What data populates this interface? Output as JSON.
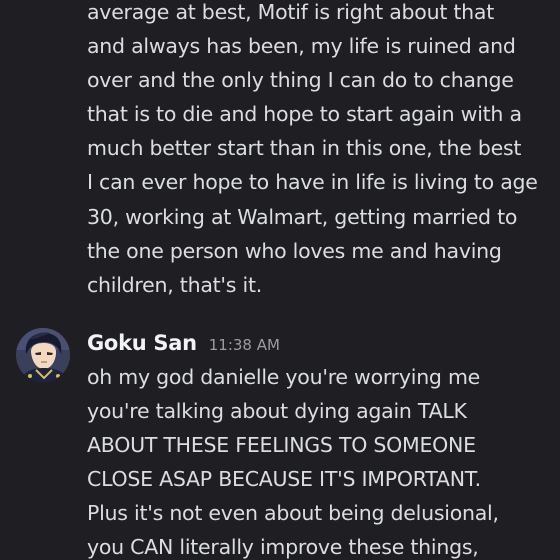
{
  "previous_message": {
    "lines": [
      "average at best, Motif is right about that",
      "and always has been, my life is ruined and",
      "over and the only thing I can do to change",
      "that is to die and hope to start again with a",
      "much better start than in this one, the best",
      "I can ever hope to have in life is living to age",
      "30, working at Walmart, getting married to",
      "the one person who loves me and having",
      "children, that's it."
    ]
  },
  "message": {
    "username": "Goku San",
    "timestamp": "11:38 AM",
    "avatar_icon": "anime-character-avatar-icon",
    "lines": [
      "oh my god danielle you're worrying me",
      "you're talking about dying again TALK",
      "ABOUT THESE FEELINGS TO SOMEONE",
      "CLOSE ASAP BECAUSE IT'S IMPORTANT.",
      "Plus it's not even about being delusional,",
      "you CAN literally improve these things,"
    ]
  },
  "colors": {
    "background": "#1f1f23",
    "text": "#dbdee1",
    "username": "#f2f3f5",
    "timestamp": "#9a9ca3"
  }
}
